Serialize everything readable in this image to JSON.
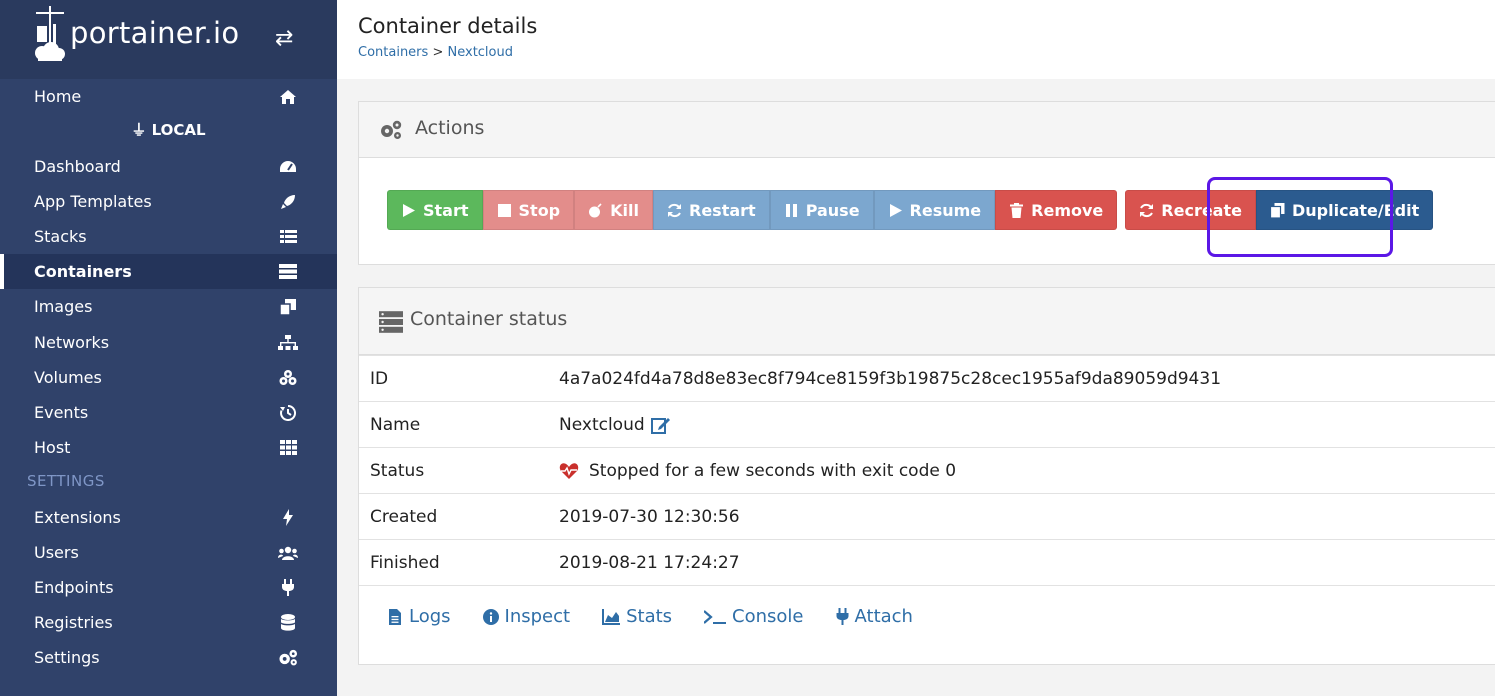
{
  "brand": {
    "logo_text": "portainer.io"
  },
  "sidebar": {
    "endpoint_label": "LOCAL",
    "settings_title": "SETTINGS",
    "items": [
      {
        "label": "Home",
        "icon": "home-icon"
      },
      {
        "label": "Dashboard",
        "icon": "tachometer-icon"
      },
      {
        "label": "App Templates",
        "icon": "rocket-icon"
      },
      {
        "label": "Stacks",
        "icon": "list-icon"
      },
      {
        "label": "Containers",
        "icon": "server-icon",
        "active": true
      },
      {
        "label": "Images",
        "icon": "clone-icon"
      },
      {
        "label": "Networks",
        "icon": "sitemap-icon"
      },
      {
        "label": "Volumes",
        "icon": "cubes-icon"
      },
      {
        "label": "Events",
        "icon": "history-icon"
      },
      {
        "label": "Host",
        "icon": "th-icon"
      },
      {
        "label": "Extensions",
        "icon": "bolt-icon"
      },
      {
        "label": "Users",
        "icon": "users-icon"
      },
      {
        "label": "Endpoints",
        "icon": "plug-icon"
      },
      {
        "label": "Registries",
        "icon": "database-icon"
      },
      {
        "label": "Settings",
        "icon": "cogs-icon"
      }
    ]
  },
  "header": {
    "title": "Container details",
    "breadcrumb_parent": "Containers",
    "breadcrumb_separator": ">",
    "breadcrumb_current": "Nextcloud"
  },
  "actions": {
    "title": "Actions",
    "buttons": {
      "start": "Start",
      "stop": "Stop",
      "kill": "Kill",
      "restart": "Restart",
      "pause": "Pause",
      "resume": "Resume",
      "remove": "Remove",
      "recreate": "Recreate",
      "duplicate": "Duplicate/Edit"
    }
  },
  "status": {
    "title": "Container status",
    "rows": {
      "id": {
        "key": "ID",
        "value": "4a7a024fd4a78d8e83ec8f794ce8159f3b19875c28cec1955af9da89059d9431"
      },
      "name": {
        "key": "Name",
        "value": "Nextcloud"
      },
      "status": {
        "key": "Status",
        "value": "Stopped for a few seconds with exit code 0"
      },
      "created": {
        "key": "Created",
        "value": "2019-07-30 12:30:56"
      },
      "finished": {
        "key": "Finished",
        "value": "2019-08-21 17:24:27"
      }
    },
    "links": {
      "logs": "Logs",
      "inspect": "Inspect",
      "stats": "Stats",
      "console": "Console",
      "attach": "Attach"
    }
  },
  "colors": {
    "sidebar_bg": "#30426a",
    "brand_bg": "#2a3a5e",
    "success": "#5cb85c",
    "danger": "#d9534f",
    "info": "#7ca7cf",
    "primary": "#2b5b8f",
    "highlight": "#5b17e6",
    "link": "#2f6ea7"
  }
}
